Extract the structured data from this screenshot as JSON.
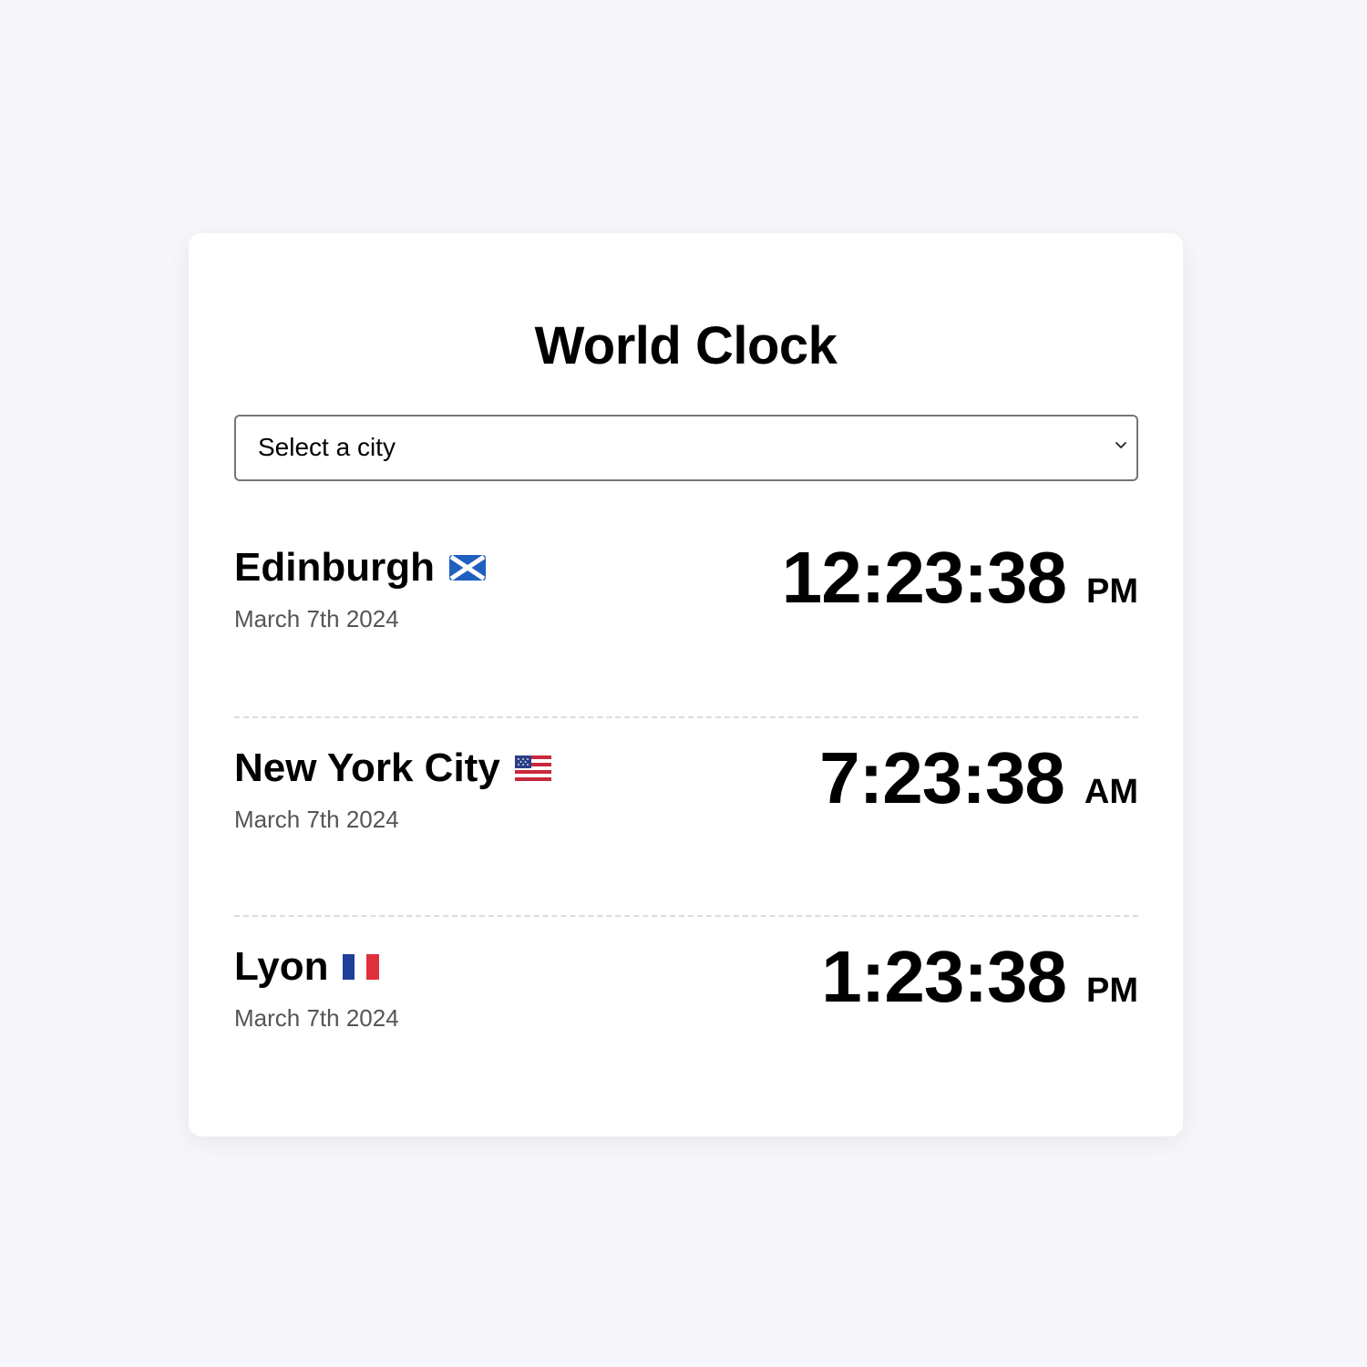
{
  "app": {
    "title": "World Clock"
  },
  "city_select": {
    "value": "Select a city",
    "chevron_icon": "chevron-down-icon"
  },
  "clocks": [
    {
      "city": "Edinburgh",
      "flag_icon": "scotland-flag-icon",
      "date": "March 7th 2024",
      "time": "12:23:38",
      "period": "PM"
    },
    {
      "city": "New York City",
      "flag_icon": "usa-flag-icon",
      "date": "March 7th 2024",
      "time": "7:23:38",
      "period": "AM"
    },
    {
      "city": "Lyon",
      "flag_icon": "france-flag-icon",
      "date": "March 7th 2024",
      "time": "1:23:38",
      "period": "PM"
    }
  ],
  "colors": {
    "background": "#f7f7fb",
    "card": "#ffffff",
    "text": "#000000",
    "date_text": "#555555",
    "divider": "#dcdcdc",
    "select_border": "#767676"
  }
}
